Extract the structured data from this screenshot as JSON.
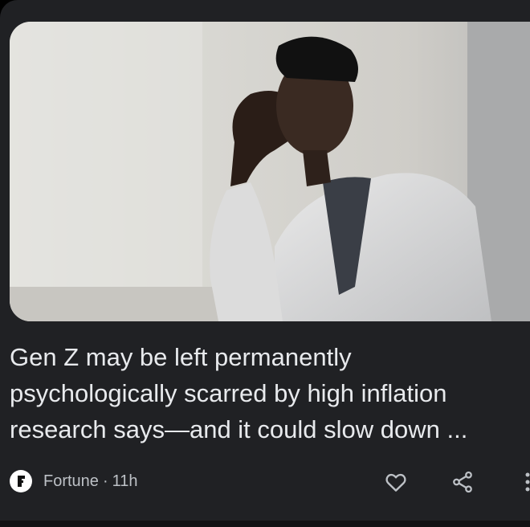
{
  "article": {
    "headline_lines": [
      "Gen Z may be left permanently",
      "psychologically scarred by high inflation",
      "research says—and it could slow down ..."
    ],
    "source": "Fortune",
    "separator": "·",
    "age": "11h",
    "image_description_icon": "photo-icon"
  },
  "actions": {
    "like_icon": "heart-icon",
    "share_icon": "share-icon",
    "more_icon": "more-vert-icon"
  },
  "colors": {
    "card_background": "#202124",
    "headline_text": "#e8eaed",
    "meta_text": "#bdc1c6",
    "icon_color": "#bdc1c6"
  }
}
